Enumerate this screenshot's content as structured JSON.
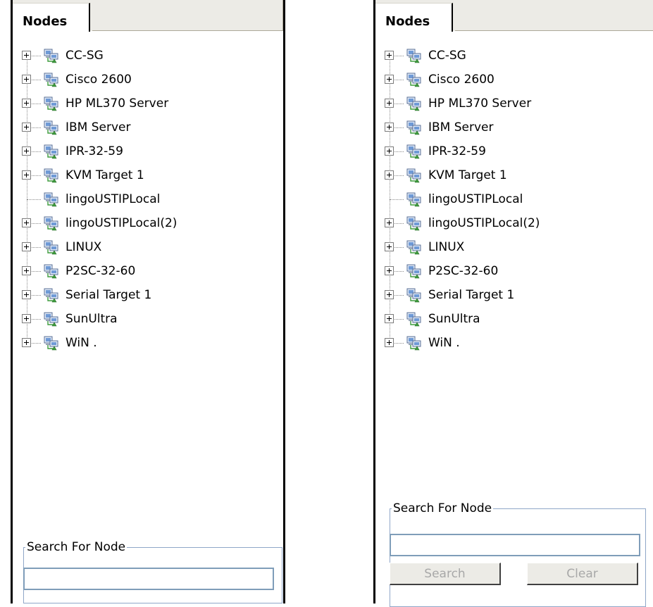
{
  "tab_label": "Nodes",
  "nodes": [
    {
      "label": "CC-SG",
      "expandable": true
    },
    {
      "label": "Cisco 2600",
      "expandable": true
    },
    {
      "label": "HP ML370 Server",
      "expandable": true
    },
    {
      "label": "IBM Server",
      "expandable": true
    },
    {
      "label": "IPR-32-59",
      "expandable": true
    },
    {
      "label": "KVM Target 1",
      "expandable": true
    },
    {
      "label": "lingoUSTIPLocal",
      "expandable": false
    },
    {
      "label": "lingoUSTIPLocal(2)",
      "expandable": true
    },
    {
      "label": "LINUX",
      "expandable": true
    },
    {
      "label": "P2SC-32-60",
      "expandable": true
    },
    {
      "label": "Serial Target 1",
      "expandable": true
    },
    {
      "label": "SunUltra",
      "expandable": true
    },
    {
      "label": "WiN .",
      "expandable": true
    }
  ],
  "search": {
    "legend": "Search For Node",
    "value": "",
    "search_button": "Search",
    "clear_button": "Clear"
  },
  "icons": {
    "expand": "plus-box-icon",
    "node": "networked-computer-icon"
  }
}
